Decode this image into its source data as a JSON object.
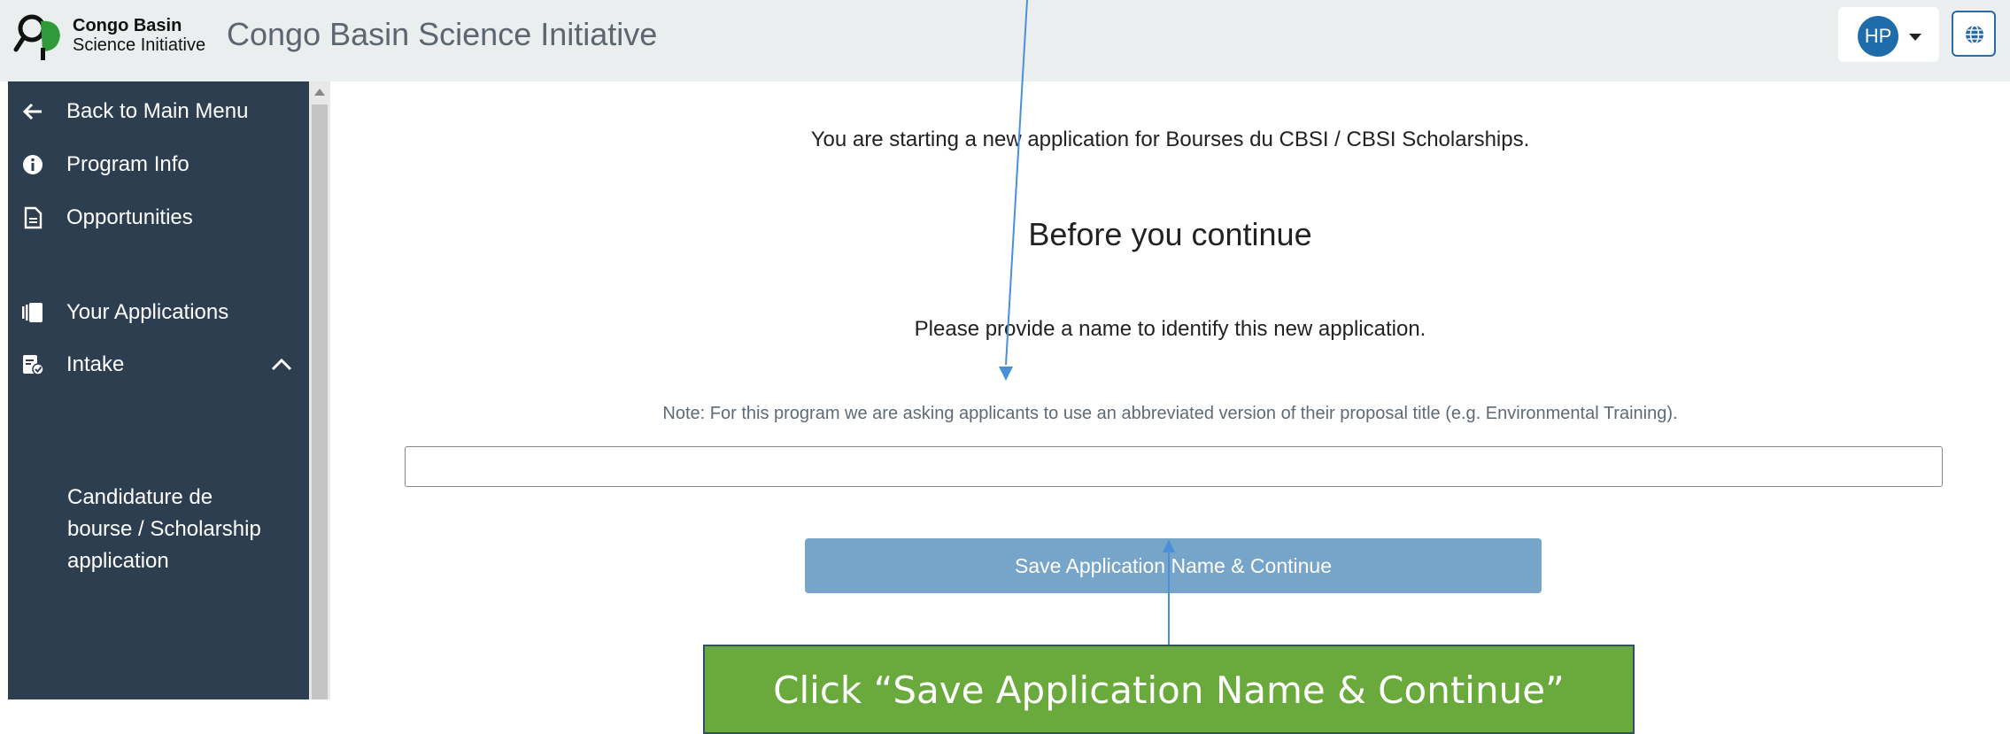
{
  "header": {
    "logo_line1": "Congo Basin",
    "logo_line2": "Science Initiative",
    "app_title": "Congo Basin Science Initiative",
    "user_initials": "HP"
  },
  "sidebar": {
    "items": [
      {
        "label": "Back to Main Menu",
        "icon": "arrow-left-icon"
      },
      {
        "label": "Program Info",
        "icon": "info-icon"
      },
      {
        "label": "Opportunities",
        "icon": "document-icon"
      },
      {
        "label": "Your Applications",
        "icon": "applications-icon"
      },
      {
        "label": "Intake",
        "icon": "intake-icon"
      }
    ],
    "sub_item": "Candidature de bourse / Scholarship application"
  },
  "main": {
    "intro": "You are starting a new application for Bourses du CBSI / CBSI Scholarships.",
    "heading": "Before you continue",
    "prompt": "Please provide a name to identify this new application.",
    "note": "Note: For this program we are asking applicants to use an abbreviated version of their proposal title (e.g. Environmental Training).",
    "input_value": "",
    "save_button": "Save Application Name & Continue"
  },
  "annotation": {
    "callout": "Click “Save Application Name & Continue”"
  },
  "colors": {
    "sidebar_bg": "#2c3e50",
    "header_bg": "#ebeeef",
    "button_bg": "#76a5c9",
    "avatar_bg": "#1f6cab",
    "callout_bg": "#6aaa3c",
    "arrow": "#4a90d9"
  }
}
